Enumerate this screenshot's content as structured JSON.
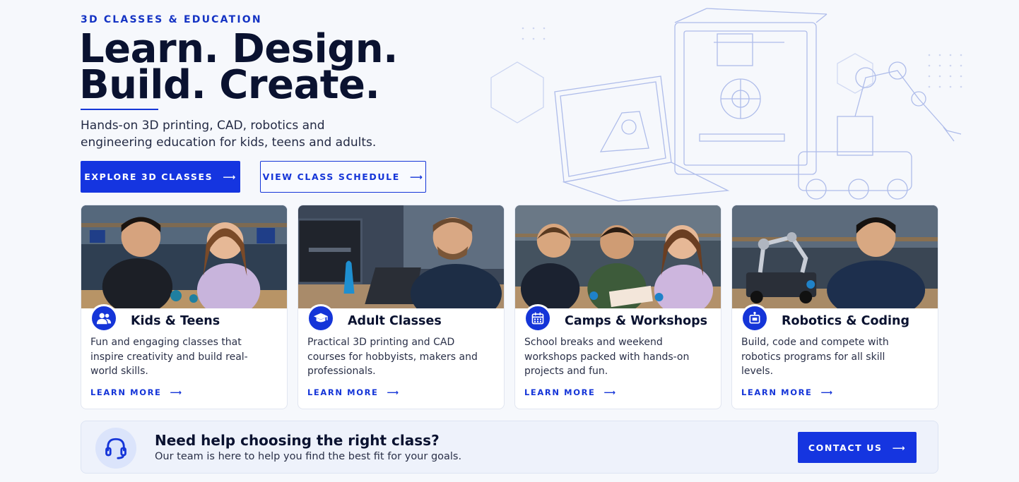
{
  "hero": {
    "eyebrow": "3D CLASSES & EDUCATION",
    "headline_line1": "Learn. Design.",
    "headline_line2": "Build. Create.",
    "subtitle": "Hands-on 3D printing, CAD, robotics and engineering education for kids, teens and adults.",
    "primary_cta": "explore 3d classes",
    "secondary_cta": "view class schedule",
    "arrow": "⟶"
  },
  "cards": [
    {
      "title": "Kids & Teens",
      "description": "Fun and engaging classes that inspire creativity and build real-world skills.",
      "link": "learn more",
      "icon": "users-icon"
    },
    {
      "title": "Adult Classes",
      "description": "Practical 3D printing and CAD courses for hobbyists, makers and professionals.",
      "link": "learn more",
      "icon": "graduation-cap-icon"
    },
    {
      "title": "Camps & Workshops",
      "description": "School breaks and weekend workshops packed with hands-on projects and fun.",
      "link": "learn more",
      "icon": "calendar-icon"
    },
    {
      "title": "Robotics & Coding",
      "description": "Build, code and compete with robotics programs for all skill levels.",
      "link": "learn more",
      "icon": "robot-icon"
    }
  ],
  "help": {
    "title": "Need help choosing the right class?",
    "subtitle": "Our team is here to help you find the best fit for your goals.",
    "cta": "contact us",
    "icon": "headset-icon"
  },
  "colors": {
    "accent": "#1535e0",
    "text": "#0a1230",
    "background": "#f6f8fc"
  }
}
